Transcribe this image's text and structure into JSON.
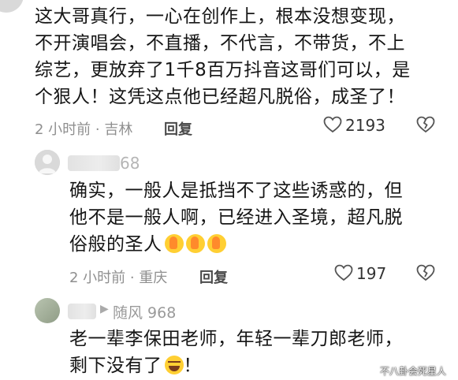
{
  "comments": [
    {
      "lines": [
        "这大哥真行，一心在创作上，根本没想变现，",
        "不开演唱会，不直播，不代言，不带货，不上",
        "综艺，更放弃了1千8百万抖音这哥们可以，是",
        "个狠人！这凭这点他已经超凡脱俗，成圣了！"
      ],
      "time_location": "2 小时前 · 吉林",
      "reply_label": "回复",
      "likes": "2193"
    },
    {
      "username_suffix": "68",
      "lines": [
        "确实，一般人是抵挡不了这些诱惑的，但",
        "他不是一般人啊，已经进入圣境，超凡脱",
        "俗般的圣人"
      ],
      "emojis": [
        "thumbs-up-emoji",
        "thumbs-up-emoji",
        "thumbs-up-emoji"
      ],
      "time_location": "2 小时前 · 重庆",
      "reply_label": "回复",
      "likes": "197"
    },
    {
      "reply_to_marker": "▶",
      "reply_to": "随风 968",
      "lines": [
        "老一辈李保田老师，年轻一辈刀郎老师，",
        "剩下没有了"
      ],
      "line2_suffix": "！",
      "time_location": "",
      "reply_label": "",
      "likes": ""
    }
  ],
  "watermark": "不八卦会死星人",
  "colors": {
    "text": "#161616",
    "meta": "#8f8f8f",
    "icon": "#555555",
    "background": "#ffffff"
  }
}
